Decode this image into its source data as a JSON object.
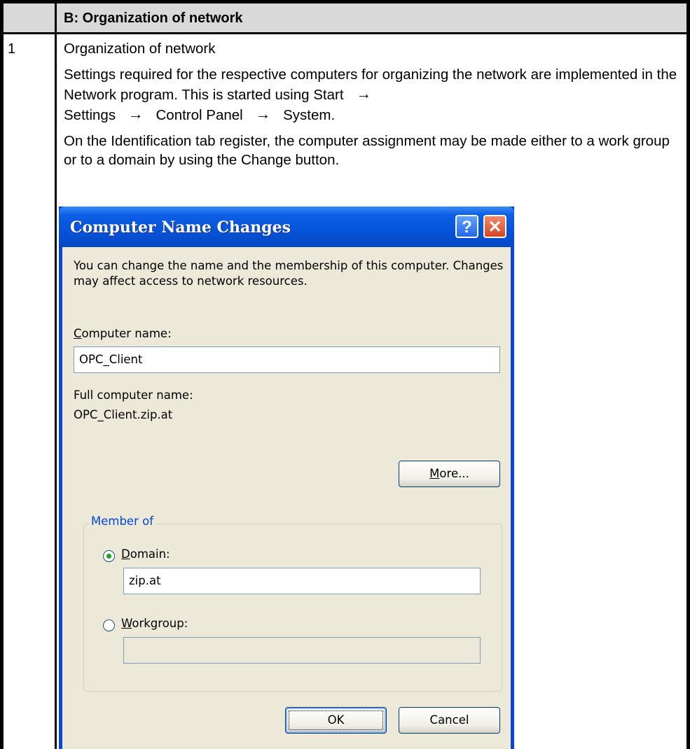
{
  "table": {
    "header": "B: Organization of network",
    "row_number": "1",
    "heading": "Organization of network",
    "para1": "Settings required for the respective computers for organizing the network are implemented in the Network program. This is started using Start",
    "path": [
      "Settings",
      "Control Panel",
      "System."
    ],
    "para2": "On the Identification tab register, the computer assignment may be made either to a work group or to a domain by using the Change button."
  },
  "dialog": {
    "title": "Computer Name Changes",
    "help_glyph": "?",
    "close_glyph": "✕",
    "description": "You can change the name and the membership of this computer. Changes may affect access to network resources.",
    "computer_name_label_mnemonic": "C",
    "computer_name_label_rest": "omputer name:",
    "computer_name_value": "OPC_Client",
    "full_name_label": "Full computer name:",
    "full_name_value": "OPC_Client.zip.at",
    "more_mnemonic": "M",
    "more_rest": "ore...",
    "member_of_label": "Member of",
    "domain_mnemonic": "D",
    "domain_rest": "omain:",
    "domain_value": "zip.at",
    "domain_checked": true,
    "workgroup_mnemonic": "W",
    "workgroup_rest": "orkgroup:",
    "workgroup_value": "",
    "ok_label": "OK",
    "cancel_label": "Cancel"
  },
  "colors": {
    "titlebar": "#0653d8",
    "dialog_face": "#ece9d8",
    "group_legend": "#0046d5",
    "close_button": "#d64523"
  },
  "icons": {
    "arrow": "right-arrow-icon",
    "help": "help-icon",
    "close": "close-icon"
  }
}
